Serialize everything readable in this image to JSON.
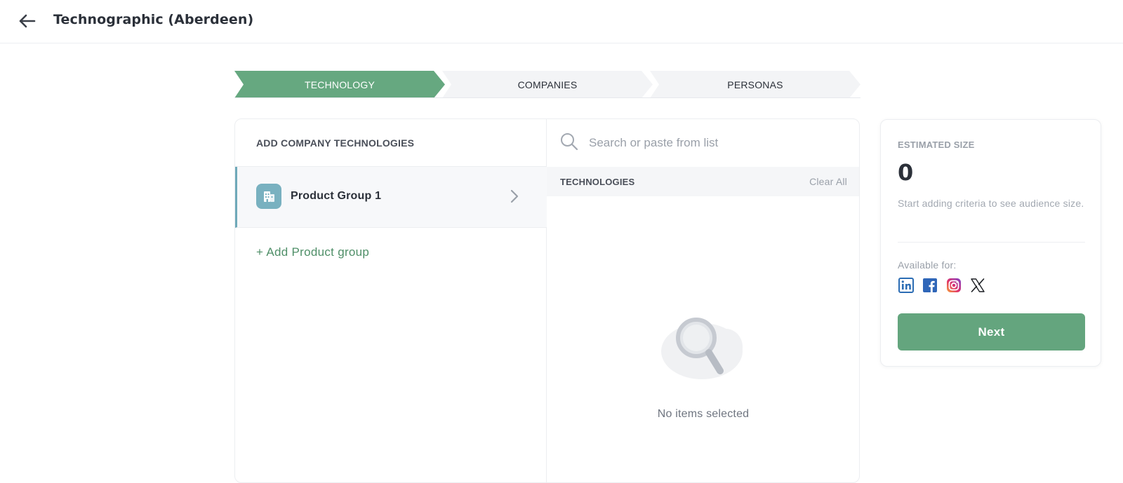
{
  "header": {
    "title": "Technographic (Aberdeen)",
    "back_icon": "arrow-left-icon"
  },
  "stepper": {
    "steps": [
      {
        "label": "TECHNOLOGY",
        "active": true
      },
      {
        "label": "COMPANIES",
        "active": false
      },
      {
        "label": "PERSONAS",
        "active": false
      }
    ]
  },
  "left_panel": {
    "title": "ADD COMPANY TECHNOLOGIES",
    "groups": [
      {
        "label": "Product Group 1",
        "icon": "building-icon",
        "selected": true
      }
    ],
    "add_group_label": "+ Add Product group"
  },
  "right_panel": {
    "search": {
      "placeholder": "Search or paste from list",
      "value": ""
    },
    "section_title": "TECHNOLOGIES",
    "clear_all_label": "Clear All",
    "empty_text": "No items selected"
  },
  "summary": {
    "estimated_label": "ESTIMATED SIZE",
    "estimated_value": "0",
    "hint": "Start adding criteria to see audience size.",
    "available_label": "Available for:",
    "platforms": [
      "linkedin-icon",
      "facebook-icon",
      "instagram-icon",
      "x-icon"
    ],
    "next_label": "Next"
  },
  "colors": {
    "accent_green": "#64a57e",
    "step_active": "#66a880",
    "step_inactive": "#f3f4f6",
    "selection_bar": "#6fa9b9",
    "link_green": "#4f8f68"
  }
}
